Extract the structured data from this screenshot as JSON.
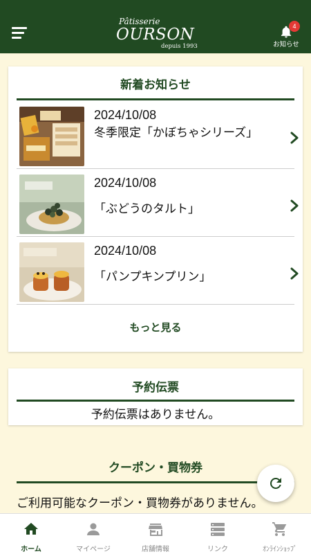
{
  "header": {
    "logo_small": "Pâtisserie",
    "logo_main": "OURSON",
    "logo_since": "depuis 1993",
    "notification_label": "お知らせ",
    "notification_count": "4"
  },
  "news": {
    "title": "新着お知らせ",
    "items": [
      {
        "date": "2024/10/08",
        "title": "冬季限定「かぼちゃシリーズ」"
      },
      {
        "date": "2024/10/08",
        "title": "「ぶどうのタルト」"
      },
      {
        "date": "2024/10/08",
        "title": "「パンプキンプリン」"
      }
    ],
    "more_label": "もっと見る"
  },
  "reservation": {
    "title": "予約伝票",
    "empty_text": "予約伝票はありません。"
  },
  "coupon": {
    "title": "クーポン・買物券",
    "empty_text": "ご利用可能なクーポン・買物券がありません。"
  },
  "tabs": [
    {
      "label": "ホーム",
      "icon": "home-icon",
      "active": true
    },
    {
      "label": "マイページ",
      "icon": "person-icon",
      "active": false
    },
    {
      "label": "店舗情報",
      "icon": "store-icon",
      "active": false
    },
    {
      "label": "リンク",
      "icon": "list-icon",
      "active": false
    },
    {
      "label": "ｵﾝﾗｲﾝｼｮｯﾌﾟ",
      "icon": "cart-icon",
      "active": false
    }
  ],
  "colors": {
    "brand_green": "#214a22",
    "background": "#fdf7dd",
    "badge_red": "#e53935"
  }
}
